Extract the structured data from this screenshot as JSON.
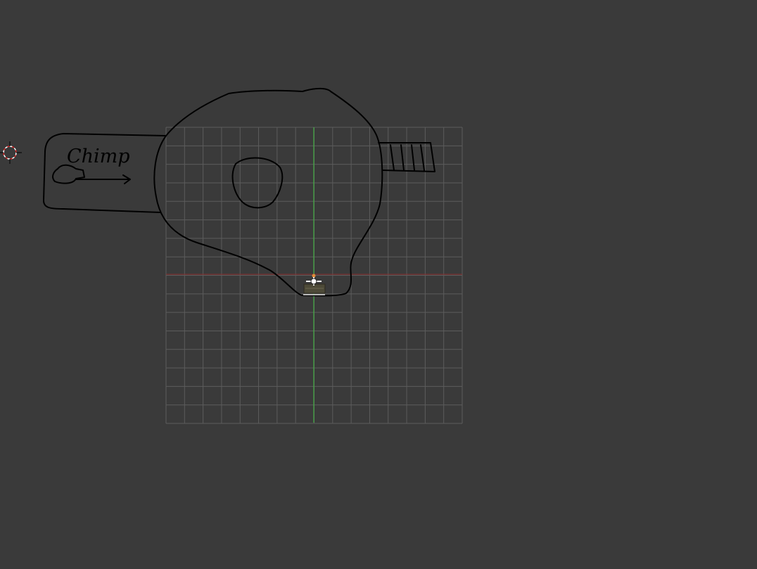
{
  "viewport": {
    "background": "#3a3a3a",
    "grid_color": "#5c5c5c",
    "x_axis_color": "#8a2e2e",
    "y_axis_color": "#3fbf3f",
    "grid_cells": 16
  },
  "sketch": {
    "label_text": "Chimp",
    "stroke_color": "#000000"
  },
  "tools": {
    "cursor_3d_icon": "cursor-3d-icon",
    "camera_icon": "camera-icon"
  }
}
